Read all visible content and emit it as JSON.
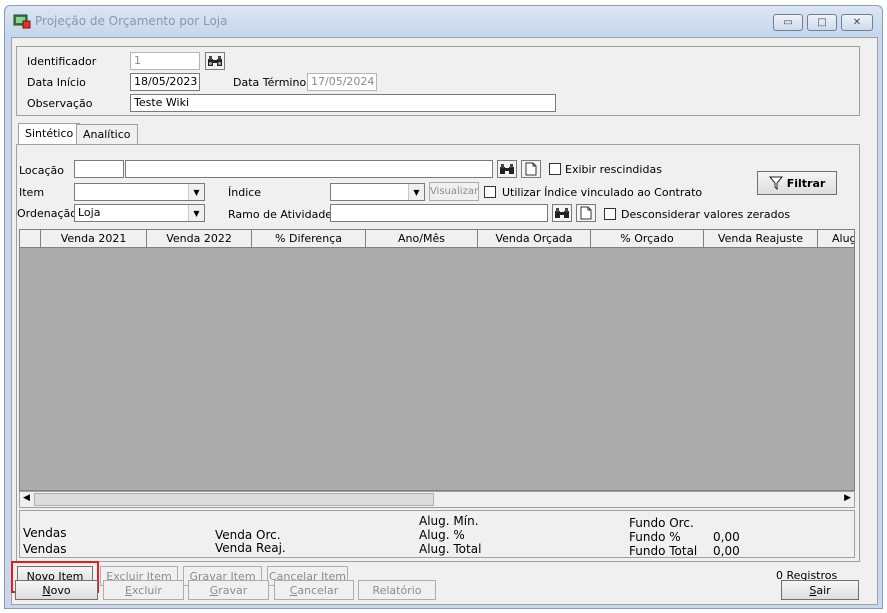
{
  "window": {
    "title": "Projeção de Orçamento por Loja",
    "controls": {
      "minimize": "▭",
      "maximize": "□",
      "close": "✕"
    }
  },
  "header": {
    "identificador_label": "Identificador",
    "identificador_value": "1",
    "data_inicio_label": "Data Início",
    "data_inicio_value": "18/05/2023",
    "data_termino_label": "Data Término",
    "data_termino_value": "17/05/2024",
    "observacao_label": "Observação",
    "observacao_value": "Teste Wiki"
  },
  "tabs": [
    {
      "label": "Sintético",
      "active": true
    },
    {
      "label": "Analítico",
      "active": false
    }
  ],
  "filters": {
    "locacao_label": "Locação",
    "locacao_code": "",
    "locacao_name": "",
    "exibir_rescindidas_label": "Exibir rescindidas",
    "item_label": "Item",
    "item_value": "",
    "indice_label": "Índice",
    "indice_value": "",
    "visualizar_label": "Visualizar",
    "utilizar_indice_label": "Utilizar Índice vinculado ao Contrato",
    "ordenacao_label": "Ordenação",
    "ordenacao_value": "Loja",
    "ramo_label": "Ramo de Atividade",
    "ramo_value": "",
    "desconsiderar_label": "Desconsiderar valores zerados",
    "filtrar_label": "Filtrar"
  },
  "grid": {
    "columns": [
      "",
      "Venda 2021",
      "Venda 2022",
      "% Diferença",
      "Ano/Mês",
      "Venda Orçada",
      "% Orçado",
      "Venda Reajuste",
      "Alug"
    ],
    "rows": []
  },
  "summary": {
    "vendas1": "Vendas",
    "vendas2": "Vendas",
    "venda_orc": "Venda Orc.",
    "venda_reaj": "Venda Reaj.",
    "alug_min": "Alug. Mín.",
    "alug_pct": "Alug. %",
    "alug_total": "Alug. Total",
    "fundo_orc": "Fundo Orc.",
    "fundo_pct": "Fundo %",
    "fundo_pct_value": "0,00",
    "fundo_total": "Fundo Total",
    "fundo_total_value": "0,00"
  },
  "item_buttons": {
    "novo_item": "Novo Item",
    "excluir_item": "Excluir Item",
    "gravar_item": "Gravar Item",
    "cancelar_item": "Cancelar Item",
    "registros": "0 Registros"
  },
  "footer": {
    "novo_first": "N",
    "novo_rest": "ovo",
    "excluir_first": "E",
    "excluir_rest": "xcluir",
    "gravar_first": "G",
    "gravar_rest": "ravar",
    "cancelar_first": "C",
    "cancelar_rest": "ancelar",
    "relatorio": "Relatório",
    "sair_first": "S",
    "sair_rest": "air"
  },
  "colors": {
    "highlight": "#e02020",
    "grid_bg": "#ababab"
  }
}
